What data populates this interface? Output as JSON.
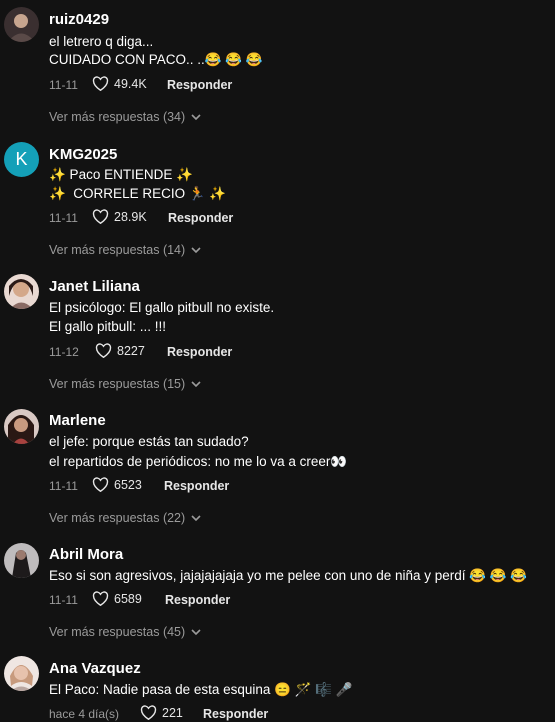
{
  "comments": [
    {
      "username": "ruiz0429",
      "avatar_initial": "",
      "lines": [
        "el letrero q diga...",
        "CUIDADO CON PACO.. ..😂 😂 😂"
      ],
      "date": "11-11",
      "likes": "49.4K",
      "reply_label": "Responder",
      "more_label": "Ver más respuestas (34)"
    },
    {
      "username": "KMG2025",
      "avatar_initial": "K",
      "lines": [
        "✨ Paco ENTIENDE ✨",
        "✨  CORRELE RECIO 🏃 ✨"
      ],
      "date": "11-11",
      "likes": "28.9K",
      "reply_label": "Responder",
      "more_label": "Ver más respuestas (14)"
    },
    {
      "username": "Janet Liliana",
      "avatar_initial": "",
      "lines": [
        "El psicólogo: El gallo pitbull no existe.",
        "El gallo pitbull: ... !!!"
      ],
      "date": "11-12",
      "likes": "8227",
      "reply_label": "Responder",
      "more_label": "Ver más respuestas (15)"
    },
    {
      "username": "Marlene",
      "avatar_initial": "",
      "lines": [
        "el jefe: porque estás tan sudado?",
        "el repartidos de periódicos: no me lo va a creer👀"
      ],
      "date": "11-11",
      "likes": "6523",
      "reply_label": "Responder",
      "more_label": "Ver más respuestas (22)"
    },
    {
      "username": "Abril Mora",
      "avatar_initial": "",
      "lines": [
        "Eso si son agresivos, jajajajajaja yo me pelee con uno de niña y perdí 😂 😂 😂"
      ],
      "date": "11-11",
      "likes": "6589",
      "reply_label": "Responder",
      "more_label": "Ver más respuestas (45)"
    },
    {
      "username": "Ana Vazquez",
      "avatar_initial": "",
      "lines": [
        "El Paco: Nadie pasa de esta esquina 😑 🪄 🎼 🎤"
      ],
      "date": "hace 4 día(s)",
      "likes": "221",
      "reply_label": "Responder",
      "more_label": ""
    }
  ],
  "colors": {
    "background": "#121212",
    "text": "#ffffff",
    "muted": "#9b9b9b",
    "avatar_k": "#14a0b8"
  },
  "icons": {
    "like": "heart-icon",
    "expand": "chevron-down-icon"
  }
}
